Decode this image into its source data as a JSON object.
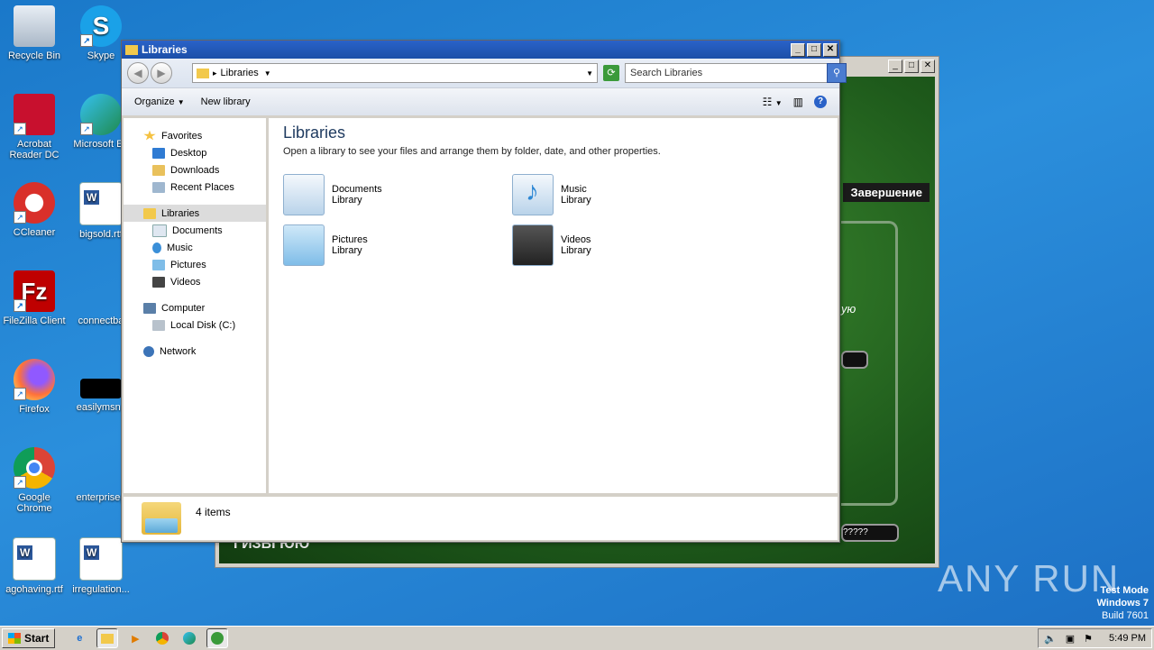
{
  "desktop": {
    "icons": [
      {
        "label": "Recycle Bin",
        "icon": "recycle-bin-icon"
      },
      {
        "label": "Skype",
        "icon": "skype-icon"
      },
      {
        "label": "Acrobat Reader DC",
        "icon": "acrobat-icon"
      },
      {
        "label": "Microsoft Ed",
        "icon": "edge-icon"
      },
      {
        "label": "CCleaner",
        "icon": "ccleaner-icon"
      },
      {
        "label": "bigsold.rtf",
        "icon": "word-doc-icon"
      },
      {
        "label": "FileZilla Client",
        "icon": "filezilla-icon"
      },
      {
        "label": "connectba",
        "icon": "blank-file-icon"
      },
      {
        "label": "Firefox",
        "icon": "firefox-icon"
      },
      {
        "label": "easilymsn.j",
        "icon": "image-file-icon"
      },
      {
        "label": "Google Chrome",
        "icon": "chrome-icon"
      },
      {
        "label": "enterpriseg",
        "icon": "blank-file-icon"
      },
      {
        "label": "agohaving.rtf",
        "icon": "word-doc-icon"
      },
      {
        "label": "irregulation...",
        "icon": "word-doc-icon"
      }
    ]
  },
  "background_app": {
    "finish_label": "Завершение",
    "side_text": "ую",
    "pill_text": "?????",
    "bottom_text": "ГИЗВГЮЮ"
  },
  "explorer": {
    "title": "Libraries",
    "address": "Libraries",
    "search_placeholder": "Search Libraries",
    "toolbar": {
      "organize": "Organize",
      "new_library": "New library"
    },
    "nav": {
      "favorites": "Favorites",
      "desktop": "Desktop",
      "downloads": "Downloads",
      "recent": "Recent Places",
      "libraries": "Libraries",
      "documents": "Documents",
      "music": "Music",
      "pictures": "Pictures",
      "videos": "Videos",
      "computer": "Computer",
      "local_disk": "Local Disk (C:)",
      "network": "Network"
    },
    "content": {
      "heading": "Libraries",
      "subtitle": "Open a library to see your files and arrange them by folder, date, and other properties.",
      "libraries": [
        {
          "name": "Documents",
          "type": "Library"
        },
        {
          "name": "Music",
          "type": "Library"
        },
        {
          "name": "Pictures",
          "type": "Library"
        },
        {
          "name": "Videos",
          "type": "Library"
        }
      ]
    },
    "status": "4 items"
  },
  "watermark": "ANY RUN",
  "system_note": {
    "line1": "Test Mode",
    "line2": "Windows 7",
    "line3": "Build 7601"
  },
  "taskbar": {
    "start": "Start",
    "clock": "5:49 PM"
  }
}
